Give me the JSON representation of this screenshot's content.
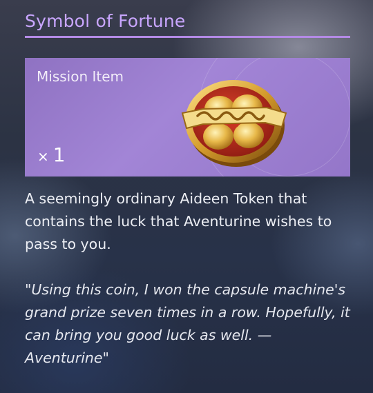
{
  "item": {
    "name": "Symbol of Fortune",
    "category": "Mission Item",
    "quantity_prefix": "×",
    "quantity": "1",
    "icon": "aideen-token-coin",
    "description": "A seemingly ordinary Aideen Token that contains the luck that Aventurine wishes to pass to you.",
    "quote": "\"Using this coin, I won the capsule machine's grand prize seven times in a row. Hopefully, it can bring you good luck as well. — Aventurine\""
  },
  "colors": {
    "title": "#c9a6ff",
    "accent_rule": "#b48ae6",
    "card_background": "#a285d6",
    "text": "#eceef4"
  }
}
